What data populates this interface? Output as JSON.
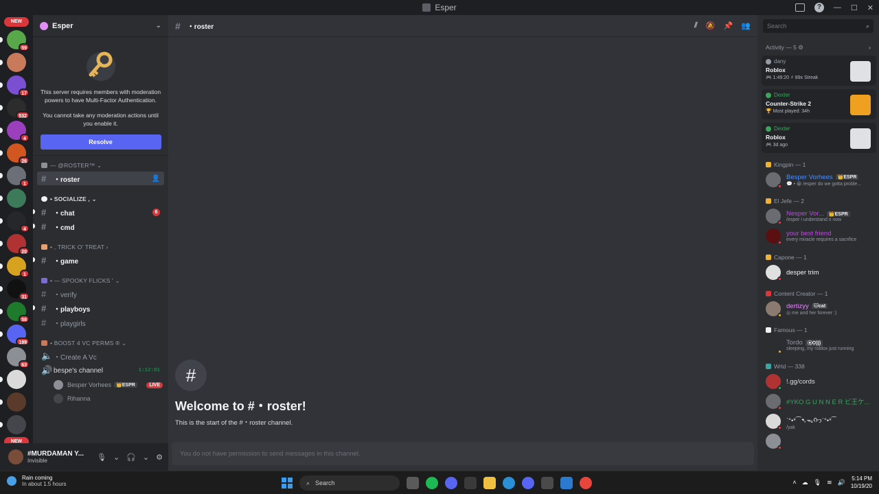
{
  "window": {
    "title": "Esper"
  },
  "rail": {
    "new_label": "NEW",
    "servers": [
      {
        "badge": "59",
        "color": "#58a84a"
      },
      {
        "badge": "",
        "color": "#c97a5b"
      },
      {
        "badge": "17",
        "color": "#7a4fd1"
      },
      {
        "badge": "532",
        "color": "#2c2c2c"
      },
      {
        "badge": "4",
        "color": "#9b3fbd"
      },
      {
        "badge": "26",
        "color": "#d1561f"
      },
      {
        "badge": "1",
        "color": "#6d6f78"
      },
      {
        "badge": "",
        "color": "#3d7a5a"
      },
      {
        "badge": "4",
        "color": "#25272b"
      },
      {
        "badge": "20",
        "color": "#b03232"
      },
      {
        "badge": "1",
        "color": "#d7a21f"
      },
      {
        "badge": "31",
        "color": "#111111"
      },
      {
        "badge": "58",
        "color": "#1f7a2c"
      },
      {
        "badge": "199",
        "color": "#5865f2"
      },
      {
        "badge": "63",
        "color": "#8d8f96"
      },
      {
        "badge": "",
        "color": "#dadada"
      },
      {
        "badge": "",
        "color": "#5a3a2a"
      },
      {
        "badge": "",
        "color": "#44464c"
      }
    ]
  },
  "sidebar": {
    "guild_name": "Esper",
    "mfa": {
      "line1": "This server requires members with moderation powers to have Multi-Factor Authentication.",
      "line2": "You cannot take any moderation actions until you enable it.",
      "button": "Resolve"
    },
    "categories": {
      "roster": "— @ROSTER™ ⌄",
      "socialize": "• SOCIALIZE , ⌄",
      "trick": "• , TRICK O' TREAT ›",
      "spooky": "• — SPOOKY FLICKS ' ⌄",
      "boost": "• BOOST 4 VC PERMS ® ⌄"
    },
    "channels": {
      "roster": "・roster",
      "chat": "・chat",
      "chat_mentions": "6",
      "cmd": "・cmd",
      "game": "・game",
      "verify": "・verify",
      "playboys": "・playboys",
      "playgirls": "・playgirls",
      "create_vc": "・Create A Vc",
      "bespe_channel": "bespe's channel",
      "bespe_time": "1:12:01"
    },
    "voice_users": [
      {
        "name": "Besper Vorhees",
        "tag": "👑ESPR",
        "live": "LIVE"
      },
      {
        "name": "Rihanna",
        "tag": "",
        "live": ""
      }
    ],
    "user": {
      "name": "#MURDAMAN Y...",
      "status": "Invisible"
    }
  },
  "main": {
    "channel_name": "・roster",
    "welcome_title": "Welcome to #・roster!",
    "welcome_sub": "This is the start of the #・roster channel.",
    "composer_placeholder": "You do not have permission to send messages in this channel."
  },
  "members": {
    "search_placeholder": "Search",
    "activity_header": "Activity — 5 ⚙",
    "activities": [
      {
        "user": "dany",
        "user_color": "#949ba4",
        "game": "Roblox",
        "meta": "🎮 1:49:20  ⚡ 89x Streak",
        "icon_color": "#dfe1e5"
      },
      {
        "user": "Dexter",
        "user_color": "#3ba55c",
        "game": "Counter-Strike 2",
        "meta": "🏆 Most played: 34h",
        "icon_color": "#f0a020"
      },
      {
        "user": "Dexter",
        "user_color": "#3ba55c",
        "game": "Roblox",
        "meta": "🎮 3d ago",
        "icon_color": "#dfe1e5"
      }
    ],
    "groups": [
      {
        "title": "Kingpin — 1",
        "icon": "#f0b232",
        "members": [
          {
            "name": "Besper Vorhees",
            "tag": "👑ESPR",
            "color": "#4f8ef7",
            "status": "💬 • 😀 /esper do we gotta proble...",
            "av": "#6a6c72",
            "st": "#f23f43"
          }
        ]
      },
      {
        "title": "El Jefe — 2",
        "icon": "#f0b232",
        "members": [
          {
            "name": "Nesper Vor...",
            "tag": "👑ESPR",
            "color": "#b84fd8",
            "status": "/esper i understand it now",
            "av": "#6a6c72",
            "st": "#f23f43"
          },
          {
            "name": "your best friend",
            "tag": "",
            "color": "#b84fd8",
            "status": "every miracle requires a sacrifice",
            "av": "#5a1010",
            "st": "#f23f43"
          }
        ]
      },
      {
        "title": "Capone — 1",
        "icon": "#f0b232",
        "members": [
          {
            "name": "desper trim",
            "tag": "",
            "color": "#f2f3f5",
            "status": "",
            "av": "#e0e0e0",
            "st": "#f23f43"
          }
        ]
      },
      {
        "title": "Content Creator — 1",
        "icon": "#da373c",
        "members": [
          {
            "name": "dertizyy",
            "tag": "🐱cat",
            "color": "#e38df7",
            "status": "◎ me and her forever :)",
            "av": "#8a7a70",
            "st": "#f0b232"
          }
        ]
      },
      {
        "title": "Famous — 1",
        "icon": "#f2f3f5",
        "members": [
          {
            "name": "Tordo",
            "tag": "⦿O)))",
            "color": "#949ba4",
            "status": "sleeping, my roblox just running",
            "av": "#2b2d31",
            "st": "#f0b232"
          }
        ]
      },
      {
        "title": "Wrld — 338",
        "icon": "#3ba5a0",
        "members": [
          {
            "name": "!.gg/cords",
            "tag": "",
            "color": "#dbdee1",
            "status": "",
            "av": "#b03232",
            "st": "#3ba55c"
          },
          {
            "name": "#YKO G U N N E R ビ王ケ...",
            "tag": "",
            "color": "#3ba55c",
            "status": "",
            "av": "#6a6c72",
            "st": "#f23f43"
          },
          {
            "name": "ˋ°•*⁀➷ᯓᡣ𐭩ˋ°•*⁀",
            "tag": "",
            "color": "#dbdee1",
            "status": "/yak",
            "av": "#dadada",
            "st": "#f23f43"
          },
          {
            "name": "",
            "tag": "",
            "color": "#dbdee1",
            "status": "",
            "av": "#8d8f96",
            "st": "#f23f43"
          }
        ]
      }
    ]
  },
  "taskbar": {
    "weather_title": "Rain coming",
    "weather_sub": "In about 1.5 hours",
    "search": "Search",
    "time": "5:14 PM",
    "date": "10/19/20"
  }
}
